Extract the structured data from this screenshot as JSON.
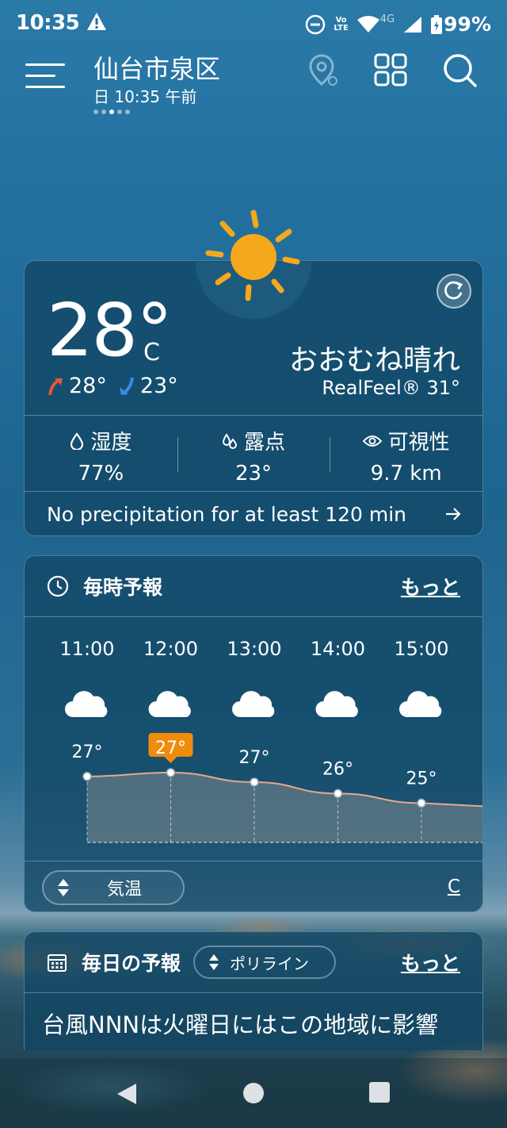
{
  "status": {
    "time": "10:35",
    "battery": "99%",
    "lte_top": "Vo",
    "lte_bottom": "LTE",
    "net_badge": "4G"
  },
  "header": {
    "city": "仙台市泉区",
    "subtitle": "日 10:35 午前"
  },
  "current": {
    "temp": "28°",
    "unit": "C",
    "high": "28°",
    "low": "23°",
    "condition": "おおむね晴れ",
    "realfeel": "RealFeel® 31°",
    "stats": [
      {
        "label": "湿度",
        "value": "77%"
      },
      {
        "label": "露点",
        "value": "23°"
      },
      {
        "label": "可視性",
        "value": "9.7 km"
      }
    ],
    "precip": "No precipitation for at least 120 min"
  },
  "hourly": {
    "title": "毎時予報",
    "more": "もっと",
    "toggle": "気温",
    "unit_link": "C",
    "hours": [
      {
        "time": "11:00",
        "temp": "27°",
        "value": 27.2
      },
      {
        "time": "12:00",
        "temp": "27°",
        "value": 27.4,
        "highlight": true
      },
      {
        "time": "13:00",
        "temp": "27°",
        "value": 26.9
      },
      {
        "time": "14:00",
        "temp": "26°",
        "value": 26.3
      },
      {
        "time": "15:00",
        "temp": "25°",
        "value": 25.8
      }
    ]
  },
  "daily": {
    "title": "毎日の予報",
    "toggle": "ポリライン",
    "more": "もっと",
    "banner": "台風NNNは火曜日にはこの地域に影響"
  },
  "colors": {
    "sun": "#f5a81c",
    "highlight": "#f08c0c",
    "high_arrow": "#e8553a",
    "low_arrow": "#3a8ae8"
  }
}
